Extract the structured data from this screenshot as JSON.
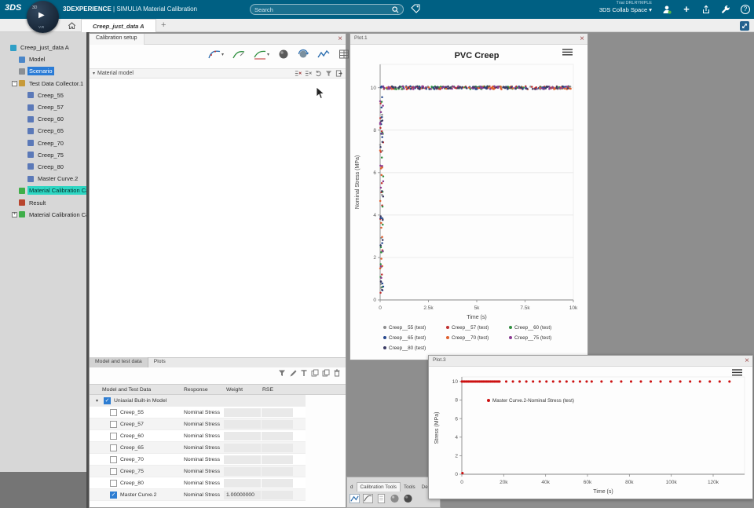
{
  "topbar": {
    "logo": "3DS",
    "brand_bold": "3DEXPERIENCE",
    "brand_sep": "|",
    "brand_app": "SIMULIA Material Calibration",
    "search_placeholder": "Search",
    "trial_label": "Trial DRLRYMPLE",
    "collab_space": "3DS Collab Space",
    "collab_caret": "▾"
  },
  "compass": {
    "top": "3D",
    "bottom": "V.R"
  },
  "tabbar": {
    "active_tab": "Creep_just_data A",
    "new_tab": "+"
  },
  "tree": {
    "items": [
      {
        "label": "Creep_just_data A",
        "level": 0,
        "icon": "db",
        "expander": null,
        "highlight": null
      },
      {
        "label": "Model",
        "level": 1,
        "icon": "model",
        "expander": null,
        "highlight": null
      },
      {
        "label": "Scenario",
        "level": 1,
        "icon": "scenario",
        "expander": null,
        "highlight": "blue"
      },
      {
        "label": "Test Data Collector.1",
        "level": 1,
        "icon": "collector",
        "expander": "minus",
        "highlight": null
      },
      {
        "label": "Creep_55",
        "level": 2,
        "icon": "curve",
        "expander": null,
        "highlight": null
      },
      {
        "label": "Creep_57",
        "level": 2,
        "icon": "curve",
        "expander": null,
        "highlight": null
      },
      {
        "label": "Creep_60",
        "level": 2,
        "icon": "curve",
        "expander": null,
        "highlight": null
      },
      {
        "label": "Creep_65",
        "level": 2,
        "icon": "curve",
        "expander": null,
        "highlight": null
      },
      {
        "label": "Creep_70",
        "level": 2,
        "icon": "curve",
        "expander": null,
        "highlight": null
      },
      {
        "label": "Creep_75",
        "level": 2,
        "icon": "curve",
        "expander": null,
        "highlight": null
      },
      {
        "label": "Creep_80",
        "level": 2,
        "icon": "curve",
        "expander": null,
        "highlight": null
      },
      {
        "label": "Master Curve.2",
        "level": 2,
        "icon": "curve",
        "expander": null,
        "highlight": null
      },
      {
        "label": "Material Calibration Ca",
        "level": 1,
        "icon": "calib",
        "expander": null,
        "highlight": "teal"
      },
      {
        "label": "Result",
        "level": 1,
        "icon": "result",
        "expander": null,
        "highlight": null
      },
      {
        "label": "Material Calibration Ca",
        "level": 1,
        "icon": "calib",
        "expander": "plus",
        "highlight": null
      }
    ]
  },
  "calibration": {
    "title": "Calibration setup",
    "section_title": "Material model",
    "tabs": [
      {
        "label": "Model and test data"
      },
      {
        "label": "Plots"
      }
    ],
    "table": {
      "headers": [
        "Model and Test Data",
        "Response",
        "Weight",
        "RSE"
      ],
      "rows": [
        {
          "name": "Uniaxial Built-in Model",
          "group": true,
          "checked": true,
          "response": "",
          "weight": "",
          "rse": ""
        },
        {
          "name": "Creep_55",
          "group": false,
          "checked": false,
          "response": "Nominal Stress",
          "weight": "",
          "rse": ""
        },
        {
          "name": "Creep_57",
          "group": false,
          "checked": false,
          "response": "Nominal Stress",
          "weight": "",
          "rse": ""
        },
        {
          "name": "Creep_60",
          "group": false,
          "checked": false,
          "response": "Nominal Stress",
          "weight": "",
          "rse": ""
        },
        {
          "name": "Creep_65",
          "group": false,
          "checked": false,
          "response": "Nominal Stress",
          "weight": "",
          "rse": ""
        },
        {
          "name": "Creep_70",
          "group": false,
          "checked": false,
          "response": "Nominal Stress",
          "weight": "",
          "rse": ""
        },
        {
          "name": "Creep_75",
          "group": false,
          "checked": false,
          "response": "Nominal Stress",
          "weight": "",
          "rse": ""
        },
        {
          "name": "Creep_80",
          "group": false,
          "checked": false,
          "response": "Nominal Stress",
          "weight": "",
          "rse": ""
        },
        {
          "name": "Master Curve.2",
          "group": false,
          "checked": true,
          "response": "Nominal Stress",
          "weight": "1.00000000",
          "rse": ""
        }
      ]
    }
  },
  "bottom_panel": {
    "tabs": [
      {
        "label": "d",
        "active": false
      },
      {
        "label": "Calibration Tools",
        "active": true
      },
      {
        "label": "Tools",
        "active": false
      },
      {
        "label": "Debu",
        "active": false
      }
    ]
  },
  "chart_data": [
    {
      "id": "plot1",
      "window_title": "Plot.1",
      "type": "scatter",
      "title": "PVC Creep",
      "xlabel": "Time (s)",
      "ylabel": "Nominal Stress (MPa)",
      "xlim": [
        0,
        10000
      ],
      "ylim": [
        0,
        11.1
      ],
      "xticks": [
        {
          "v": 0,
          "t": "0"
        },
        {
          "v": 2500,
          "t": "2.5k"
        },
        {
          "v": 5000,
          "t": "5k"
        },
        {
          "v": 7500,
          "t": "7.5k"
        },
        {
          "v": 10000,
          "t": "10k"
        }
      ],
      "yticks": [
        {
          "v": 0,
          "t": "0"
        },
        {
          "v": 2,
          "t": "2"
        },
        {
          "v": 4,
          "t": "4"
        },
        {
          "v": 6,
          "t": "6"
        },
        {
          "v": 8,
          "t": "8"
        },
        {
          "v": 10,
          "t": "10"
        }
      ],
      "grid": "horizontal",
      "legend_position": "bottom",
      "seed": 42,
      "series": [
        {
          "name": "Creep__55 (test)",
          "color": "#8d8d8d",
          "pattern": {
            "band_y": 10,
            "band_jitter": 0.14,
            "band_n": 55,
            "col_x_max": 160,
            "col_n": 13,
            "col_y_min": 0.3,
            "col_y_max": 9.8
          }
        },
        {
          "name": "Creep__57 (test)",
          "color": "#c03030",
          "pattern": {
            "band_y": 10,
            "band_jitter": 0.14,
            "band_n": 55,
            "col_x_max": 160,
            "col_n": 13,
            "col_y_min": 0.3,
            "col_y_max": 9.8
          }
        },
        {
          "name": "Creep__60 (test)",
          "color": "#2f8f3f",
          "pattern": {
            "band_y": 10,
            "band_jitter": 0.14,
            "band_n": 55,
            "col_x_max": 160,
            "col_n": 13,
            "col_y_min": 0.3,
            "col_y_max": 9.8
          }
        },
        {
          "name": "Creep__65 (test)",
          "color": "#27498e",
          "pattern": {
            "band_y": 10,
            "band_jitter": 0.14,
            "band_n": 55,
            "col_x_max": 160,
            "col_n": 13,
            "col_y_min": 0.3,
            "col_y_max": 9.8
          }
        },
        {
          "name": "Creep__70 (test)",
          "color": "#e0602f",
          "pattern": {
            "band_y": 10,
            "band_jitter": 0.14,
            "band_n": 55,
            "col_x_max": 160,
            "col_n": 13,
            "col_y_min": 0.3,
            "col_y_max": 9.8
          }
        },
        {
          "name": "Creep__75 (test)",
          "color": "#8b3a92",
          "pattern": {
            "band_y": 10,
            "band_jitter": 0.14,
            "band_n": 55,
            "col_x_max": 160,
            "col_n": 13,
            "col_y_min": 0.3,
            "col_y_max": 9.8
          }
        },
        {
          "name": "Creep__80 (test)",
          "color": "#3c3c64",
          "pattern": {
            "band_y": 10,
            "band_jitter": 0.14,
            "band_n": 55,
            "col_x_max": 160,
            "col_n": 13,
            "col_y_min": 0.3,
            "col_y_max": 9.8
          }
        }
      ],
      "note": "Creep test data: nominal stress ~10 MPa held over 0-10k s; loading ramp points near t=0 span 0-10 MPa"
    },
    {
      "id": "plot3",
      "window_title": "Plot.3",
      "type": "scatter",
      "title": "",
      "xlabel": "Time (s)",
      "ylabel": "Stress (MPa)",
      "xlim": [
        0,
        135000
      ],
      "ylim": [
        0,
        10.5
      ],
      "xticks": [
        {
          "v": 0,
          "t": "0"
        },
        {
          "v": 20000,
          "t": "20k"
        },
        {
          "v": 40000,
          "t": "40k"
        },
        {
          "v": 60000,
          "t": "60k"
        },
        {
          "v": 80000,
          "t": "80k"
        },
        {
          "v": 100000,
          "t": "100k"
        },
        {
          "v": 120000,
          "t": "120k"
        }
      ],
      "yticks": [
        {
          "v": 0,
          "t": "0"
        },
        {
          "v": 2,
          "t": "2"
        },
        {
          "v": 4,
          "t": "4"
        },
        {
          "v": 6,
          "t": "6"
        },
        {
          "v": 8,
          "t": "8"
        },
        {
          "v": 10,
          "t": "10"
        }
      ],
      "grid": "none",
      "legend_position": "inside",
      "seed": 7,
      "series": [
        {
          "name": "Master Curve.2-Nominal Stress (test)",
          "color": "#cc1111",
          "y": 10,
          "segments": [
            {
              "from": 0,
              "to": 18000,
              "step": 650
            },
            {
              "from": 18000,
              "to": 62000,
              "step": 3200
            },
            {
              "from": 62000,
              "to": 132000,
              "step": 4700
            }
          ],
          "extra_points": [
            [
              300,
              0.12
            ]
          ]
        }
      ],
      "note": "Master curve: stress ~10 MPa from t=0 to ~132k s, one point at origin"
    }
  ]
}
